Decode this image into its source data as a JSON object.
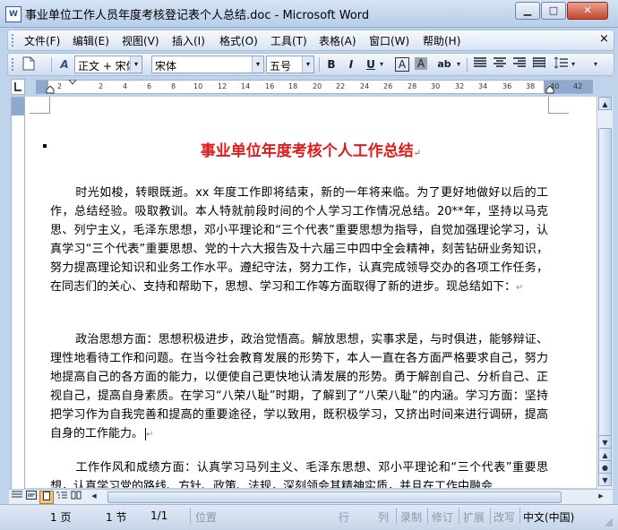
{
  "window": {
    "title": "事业单位工作人员年度考核登记表个人总结.doc - Microsoft Word",
    "icon": "W",
    "controls": {
      "minimize": "▁",
      "maximize": "□",
      "close": "✕"
    }
  },
  "menu": {
    "items": [
      "文件(F)",
      "编辑(E)",
      "视图(V)",
      "插入(I)",
      "格式(O)",
      "工具(T)",
      "表格(A)",
      "窗口(W)",
      "帮助(H)"
    ],
    "close_doc": "×"
  },
  "toolbar": {
    "style_icon": "A",
    "style_value": "正文 + 宋体",
    "font_value": "宋体",
    "size_value": "五号",
    "bold": "B",
    "italic": "I",
    "underline": "U",
    "char_border": "A",
    "char_shading": "A",
    "highlight": "ab",
    "dropdown": "▾"
  },
  "ruler": {
    "ticks": [
      "2",
      "2",
      "4",
      "6",
      "8",
      "10",
      "12",
      "14",
      "16",
      "18",
      "20",
      "22",
      "24",
      "26",
      "28",
      "30",
      "32",
      "34",
      "36",
      "38",
      "40",
      "42"
    ]
  },
  "document": {
    "title": "事业单位年度考核个人工作总结",
    "para_mark": "↵",
    "paragraphs": [
      "时光如梭，转眼既逝。xx 年度工作即将结束，新的一年将来临。为了更好地做好以后的工作，总结经验。吸取教训。本人特就前段时间的个人学习工作情况总结。20**年，坚持以马克思、列宁主义，毛泽东思想，邓小平理论和“三个代表”重要思想为指导，自觉加强理论学习，认真学习“三个代表”重要思想、党的十六大报告及十六届三中四中全会精神，刻苦钻研业务知识，努力提高理论知识和业务工作水平。遵纪守法，努力工作，认真完成领导交办的各项工作任务，在同志们的关心、支持和帮助下，思想、学习和工作等方面取得了新的进步。现总结如下：",
      "政治思想方面：思想积极进步，政治觉悟高。解放思想，实事求是，与时俱进，能够辩证、理性地看待工作和问题。在当今社会教育发展的形势下，本人一直在各方面严格要求自己，努力地提高自己的各方面的能力，以便使自己更快地认清发展的形势。勇于解剖自己、分析自己、正视自己，提高自身素质。在学习“八荣八耻”时期，了解到了“八荣八耻”的内涵。学习方面：坚持把学习作为自我完善和提高的重要途径，学以致用，既积极学习，又挤出时间来进行调研，提高自身的工作能力。",
      "工作作风和成绩方面：认真学习马列主义、毛泽东思想、邓小平理论和“三个代表”重要思想，认真学习党的路线、方针、政策、法规，深刻领会其精神实质，并且在工作中融会"
    ]
  },
  "scrollbars": {
    "up": "▲",
    "down": "▼",
    "prev_page": "▲",
    "select_browse": "●",
    "next_page": "▼"
  },
  "status": {
    "page": "1 页",
    "section": "1 节",
    "pages": "1/1",
    "position": "位置",
    "line": "行",
    "column": "列",
    "rec": "录制",
    "trk": "修订",
    "ext": "扩展",
    "ovr": "改写",
    "language": "中文(中国)"
  }
}
